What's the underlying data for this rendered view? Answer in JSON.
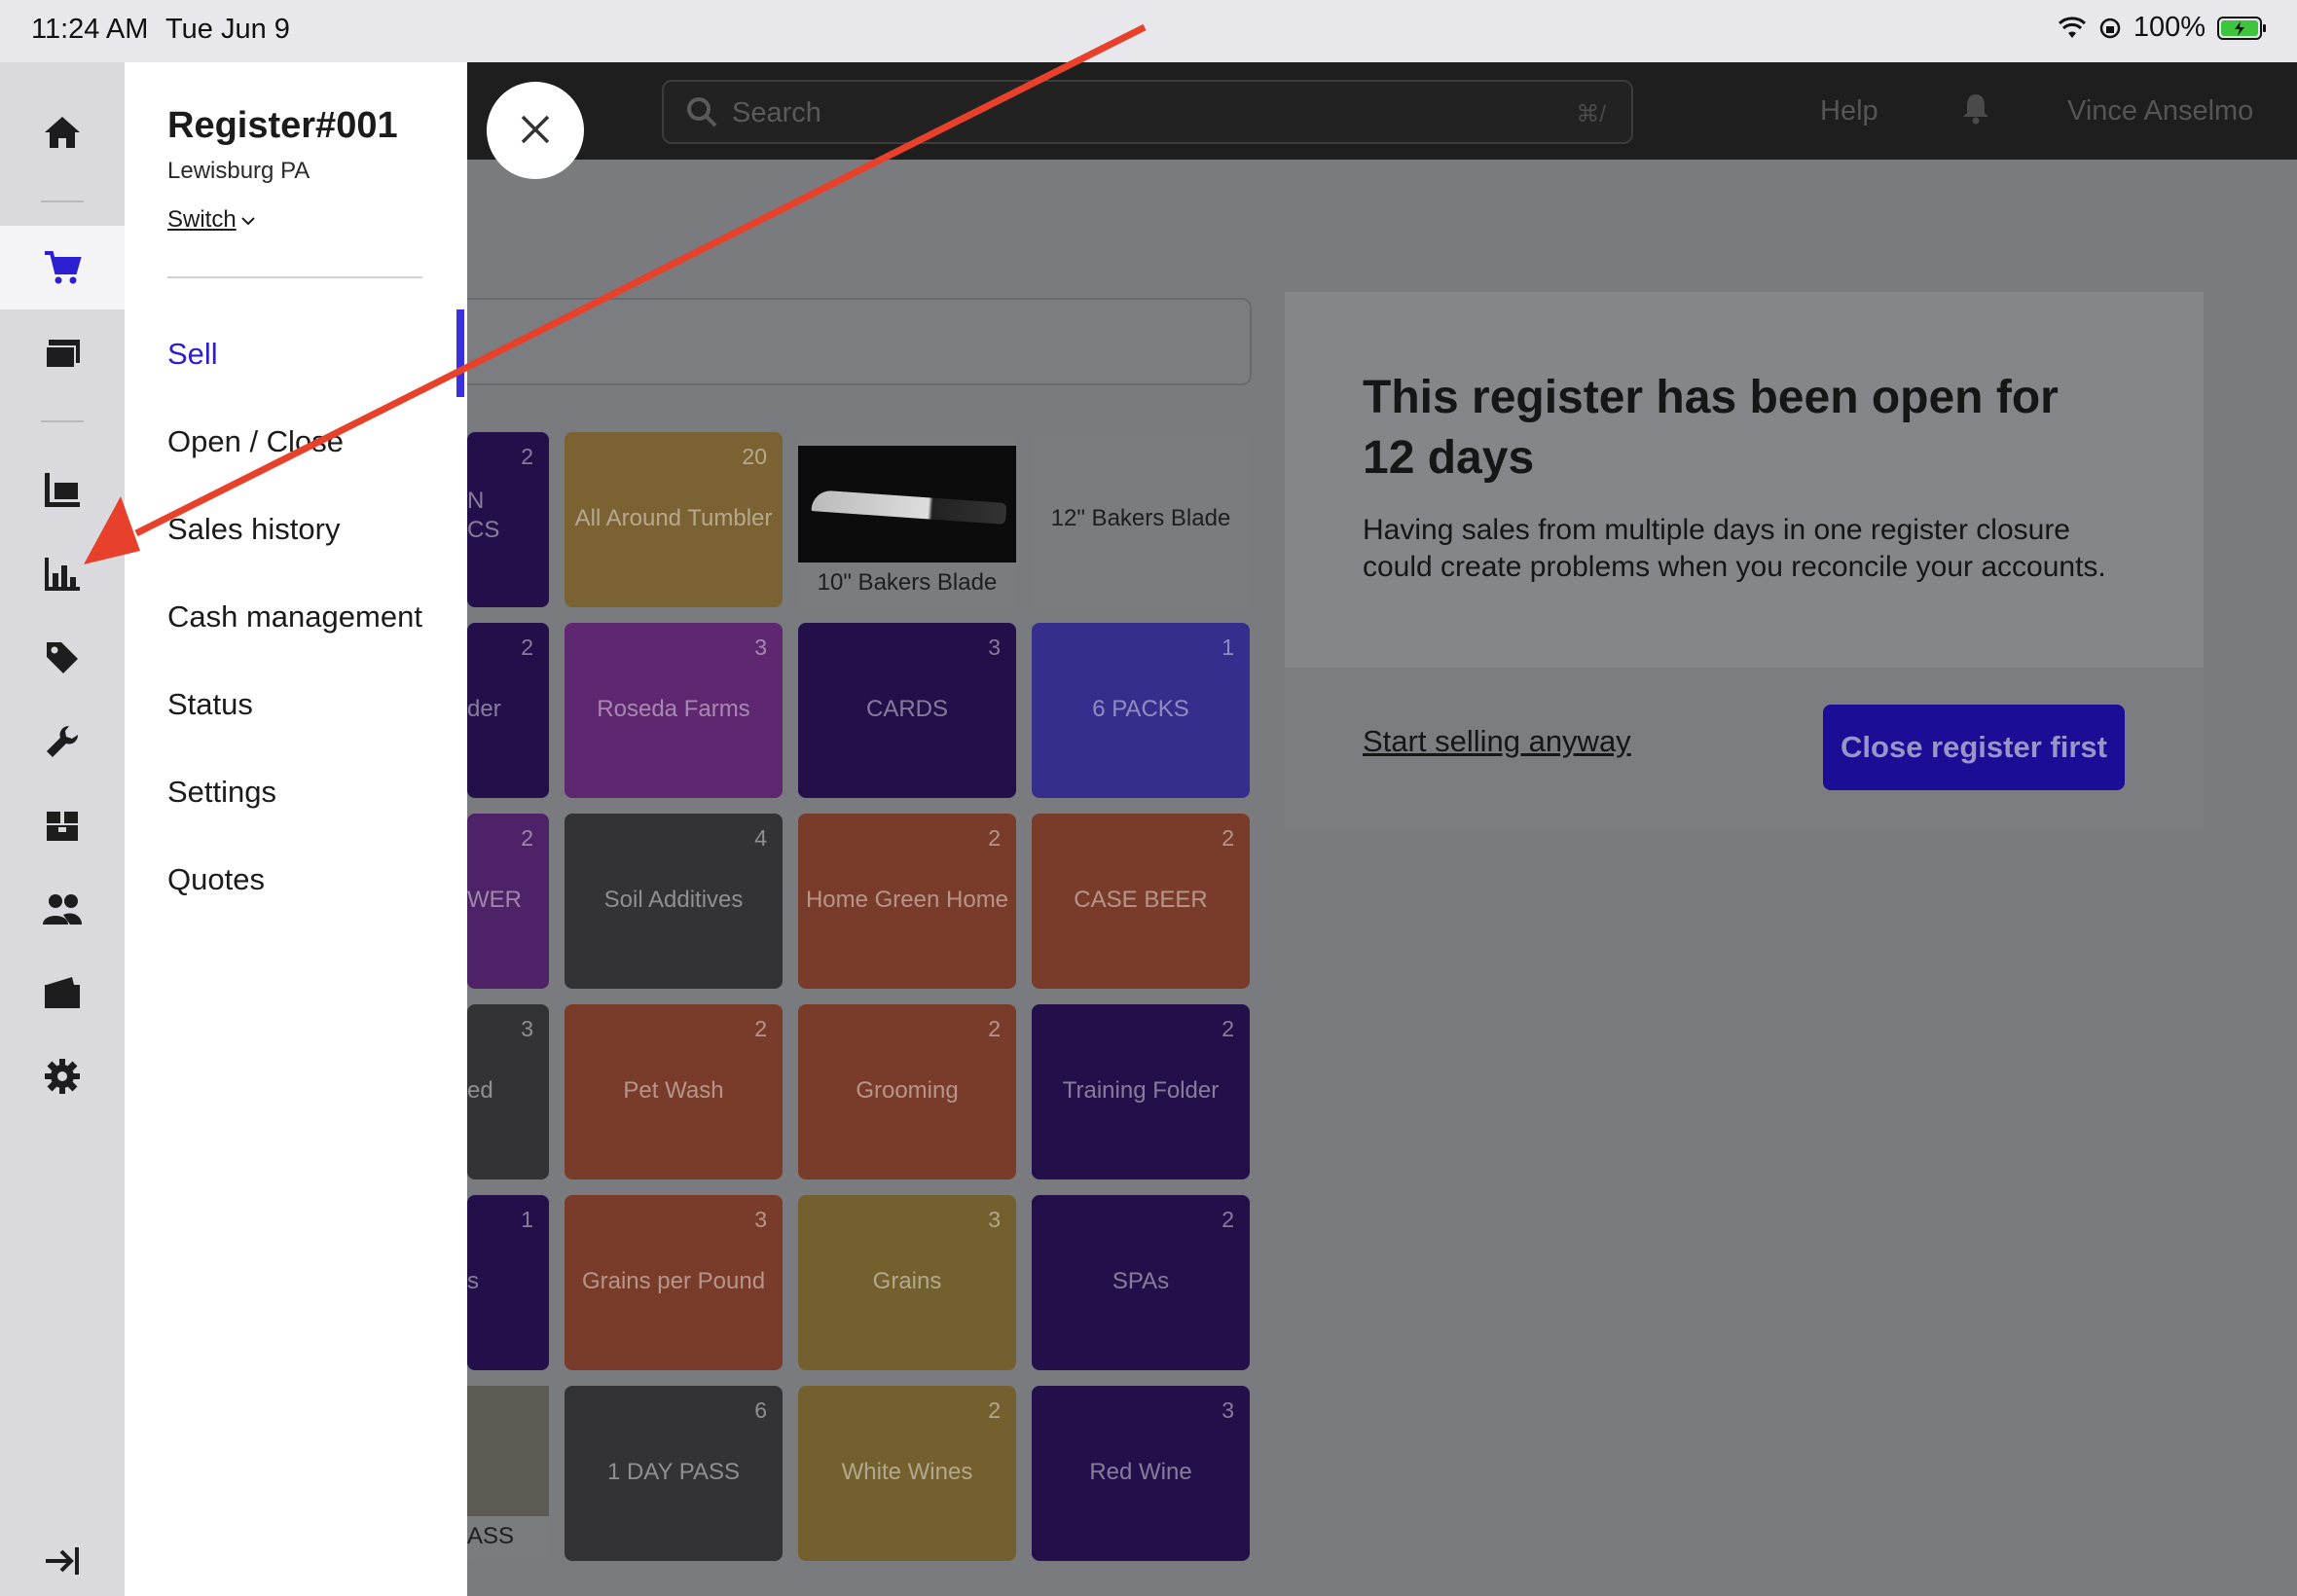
{
  "status_bar": {
    "time": "11:24 AM",
    "date": "Tue Jun 9",
    "battery": "100%"
  },
  "topbar": {
    "search_placeholder": "Search",
    "search_shortcut": "⌘/",
    "help": "Help",
    "user": "Vince Anselmo"
  },
  "drawer": {
    "register": "Register#001",
    "location": "Lewisburg PA",
    "switch": "Switch",
    "menu": [
      "Sell",
      "Open / Close",
      "Sales history",
      "Cash management",
      "Status",
      "Settings",
      "Quotes"
    ],
    "selected": "Sell"
  },
  "rail_icons": [
    "home-icon",
    "cart-icon",
    "gallery-icon",
    "inventory-icon",
    "reports-icon",
    "tag-icon",
    "wrench-icon",
    "stock-icon",
    "customers-icon",
    "wallet-icon",
    "gear-icon",
    "collapse-icon"
  ],
  "modal": {
    "title": "This register has been open for 12 days",
    "body": "Having sales from multiple days in one register closure could create problems when you reconcile your accounts.",
    "start_link": "Start selling anyway",
    "close_button": "Close register first"
  },
  "tiles": [
    {
      "label": "N\nCS",
      "count": "2",
      "color": "#23104a"
    },
    {
      "label": "All Around Tumbler",
      "count": "20",
      "color": "#7a6233"
    },
    {
      "label": "10\" Bakers Blade",
      "count": "",
      "color": "img"
    },
    {
      "label": "12\" Bakers Blade",
      "count": "",
      "color": "#7b7c7e"
    },
    {
      "label": "der",
      "count": "2",
      "color": "#23104a"
    },
    {
      "label": "Roseda Farms",
      "count": "3",
      "color": "#5e2770"
    },
    {
      "label": "CARDS",
      "count": "3",
      "color": "#23104a"
    },
    {
      "label": "6 PACKS",
      "count": "1",
      "color": "#362e8c"
    },
    {
      "label": "WER",
      "count": "2",
      "color": "#4e2266"
    },
    {
      "label": "Soil Additives",
      "count": "4",
      "color": "#333336"
    },
    {
      "label": "Home Green Home",
      "count": "2",
      "color": "#7a3c2a"
    },
    {
      "label": "CASE BEER",
      "count": "2",
      "color": "#7a3c2a"
    },
    {
      "label": "ed",
      "count": "3",
      "color": "#333336"
    },
    {
      "label": "Pet Wash",
      "count": "2",
      "color": "#7a3c2a"
    },
    {
      "label": "Grooming",
      "count": "2",
      "color": "#7a3c2a"
    },
    {
      "label": "Training Folder",
      "count": "2",
      "color": "#23104a"
    },
    {
      "label": "s",
      "count": "1",
      "color": "#23104a"
    },
    {
      "label": "Grains per Pound",
      "count": "3",
      "color": "#7a3c2a"
    },
    {
      "label": "Grains",
      "count": "3",
      "color": "#74602e"
    },
    {
      "label": "SPAs",
      "count": "2",
      "color": "#23104a"
    },
    {
      "label": "ASS",
      "count": "",
      "color": "img2"
    },
    {
      "label": "1 DAY PASS",
      "count": "6",
      "color": "#333336"
    },
    {
      "label": "White Wines",
      "count": "2",
      "color": "#74602e"
    },
    {
      "label": "Red Wine",
      "count": "3",
      "color": "#23104a"
    }
  ]
}
